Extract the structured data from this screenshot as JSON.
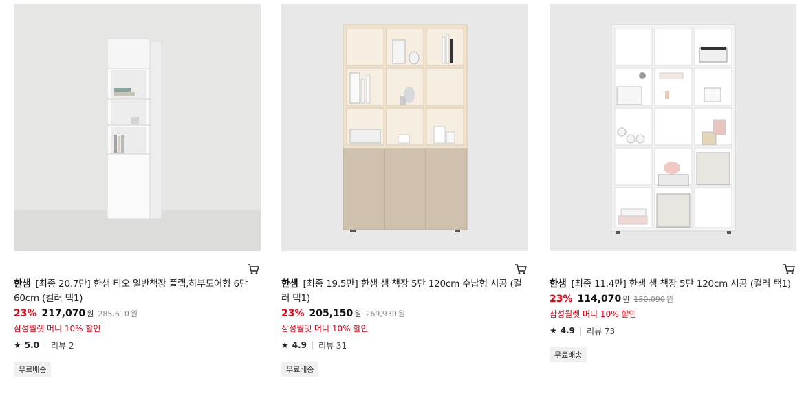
{
  "products": [
    {
      "brand": "한샘",
      "title": "[최종 20.7만] 한샘 티오 일반책장 플랩,하부도어형 6단 60cm (컬러 택1)",
      "discount": "23%",
      "price": "217,070",
      "won": "원",
      "original_price": "285,610",
      "promo": "삼성월렛 머니 10% 할인",
      "rating": "5.0",
      "reviews": "리뷰 2",
      "badge": "무료배송",
      "image_bg": "#e6e6e4"
    },
    {
      "brand": "한샘",
      "title": "[최종 19.5만] 한샘 샘 책장 5단 120cm 수납형 시공 (컬러 택1)",
      "discount": "23%",
      "price": "205,150",
      "won": "원",
      "original_price": "269,930",
      "promo": "삼성월렛 머니 10% 할인",
      "rating": "4.9",
      "reviews": "리뷰 31",
      "badge": "무료배송",
      "image_bg": "#e8e8e8"
    },
    {
      "brand": "한샘",
      "title": "[최종 11.4만] 한샘 샘 책장 5단 120cm 시공 (컬러 택1)",
      "discount": "23%",
      "price": "114,070",
      "won": "원",
      "original_price": "150,090",
      "promo": "삼성월렛 머니 10% 할인",
      "rating": "4.9",
      "reviews": "리뷰 73",
      "badge": "무료배송",
      "image_bg": "#e8e8e8"
    }
  ],
  "icons": {
    "cart": "cart-icon",
    "star": "star-icon"
  },
  "colors": {
    "accent_red": "#e60012",
    "badge_bg": "#f0f0f0"
  }
}
